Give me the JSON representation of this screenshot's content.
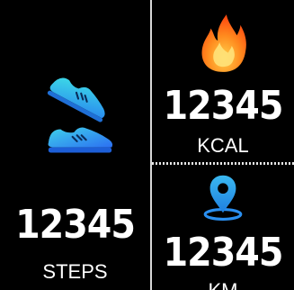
{
  "steps": {
    "value": "12345",
    "unit": "STEPS",
    "icon": "shoes-icon"
  },
  "calories": {
    "value": "12345",
    "unit": "KCAL",
    "icon": "flame-icon"
  },
  "distance": {
    "value": "12345",
    "unit": "KM",
    "icon": "location-pin-icon"
  },
  "colors": {
    "background": "#000000",
    "text": "#ffffff",
    "shoe_gradient_top": "#38d6e8",
    "shoe_gradient_bottom": "#2d7df0",
    "flame_outer": "#ff6a1a",
    "flame_inner": "#ffd54a",
    "pin": "#2ea7f0"
  }
}
